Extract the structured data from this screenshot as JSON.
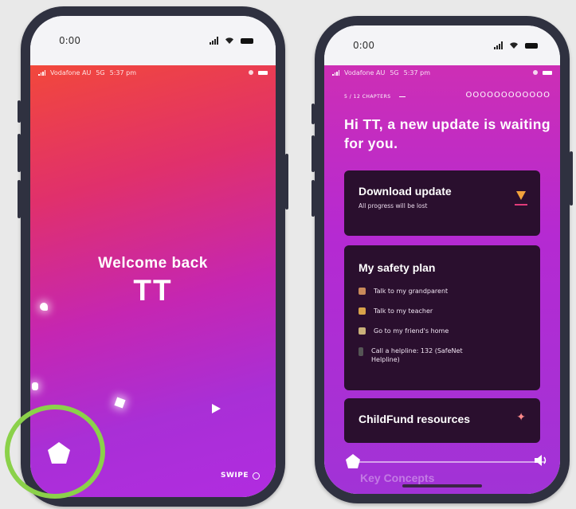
{
  "left_phone": {
    "status_time": "0:00",
    "carrier": "Vodafone AU",
    "network": "5G",
    "clock": "5:37 pm",
    "welcome": "Welcome back",
    "name": "TT",
    "swipe": "SWIPE"
  },
  "right_phone": {
    "status_time": "0:00",
    "carrier": "Vodafone AU",
    "network": "5G",
    "clock": "5:37 pm",
    "chapters": "5 / 12 CHAPTERS",
    "progress_circles": "OOOOOOOOOOOO",
    "headline": "Hi TT, a new update is waiting for you.",
    "download_card": {
      "title": "Download update",
      "subtitle": "All progress will be lost"
    },
    "safety_plan": {
      "title": "My safety plan",
      "items": [
        {
          "label": "Talk to my grandparent",
          "icon": "grandparent-icon"
        },
        {
          "label": "Talk to my teacher",
          "icon": "teacher-icon"
        },
        {
          "label": "Go to my friend's home",
          "icon": "home-icon"
        },
        {
          "label": "Call a helpline: 132 (SafeNet Helpline)",
          "icon": "phone-icon"
        }
      ]
    },
    "resources": {
      "title": "ChildFund resources"
    },
    "key_concepts": "Key Concepts"
  },
  "colors": {
    "highlight_ring": "#8bd14a",
    "card_bg": "#2a0f2e",
    "accent_orange": "#f2a23c"
  }
}
